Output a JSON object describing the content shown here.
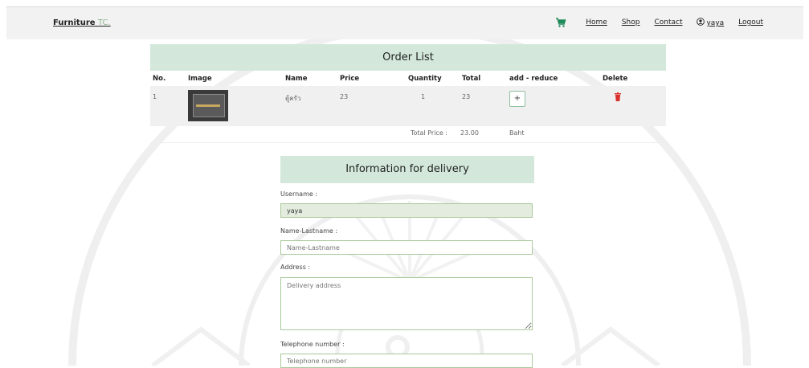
{
  "nav": {
    "brand_main": "Furniture",
    "brand_accent": "TC.",
    "links": {
      "home": "Home",
      "shop": "Shop",
      "contact": "Contact",
      "user": "yaya",
      "logout": "Logout"
    },
    "cart_icon": "cart-icon",
    "user_icon": "user-circle-icon"
  },
  "order": {
    "title": "Order List",
    "columns": {
      "no": "No.",
      "image": "Image",
      "name": "Name",
      "price": "Price",
      "quantity": "Quantity",
      "total": "Total",
      "add_reduce": "add - reduce",
      "delete": "Delete"
    },
    "rows": [
      {
        "no": "1",
        "name": "ตู้ครัว",
        "price": "23",
        "quantity": "1",
        "total": "23",
        "add_label": "+"
      }
    ],
    "total_price_label": "Total Price :",
    "total_price_value": "23.00",
    "currency": "Baht"
  },
  "delivery": {
    "title": "Information for delivery",
    "username_label": "Username :",
    "username_value": "yaya",
    "name_label": "Name-Lastname :",
    "name_placeholder": "Name-Lastname",
    "address_label": "Address :",
    "address_placeholder": "Delivery address",
    "phone_label": "Telephone number :",
    "phone_placeholder": "Telephone number"
  },
  "colors": {
    "header_bg": "#d3e8db",
    "accent": "#8fb68f",
    "delete": "#d9302c"
  }
}
